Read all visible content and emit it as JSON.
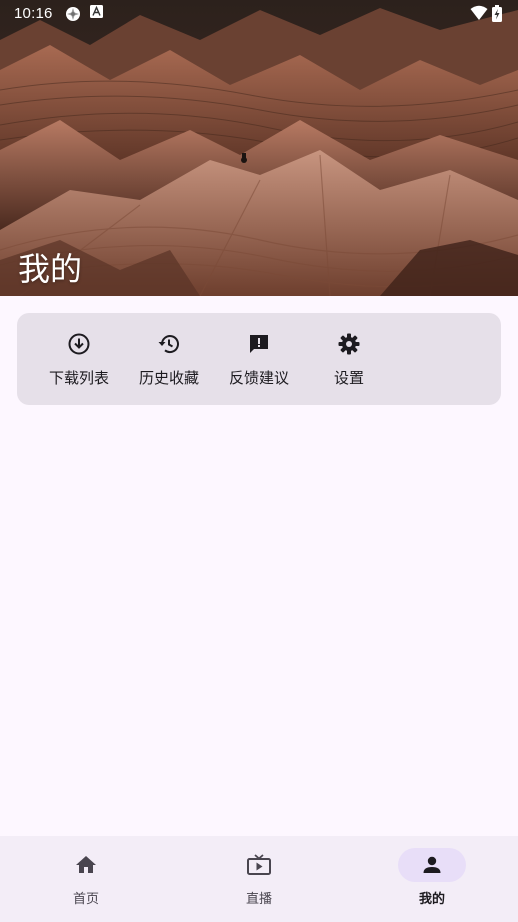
{
  "status_bar": {
    "time": "10:16",
    "icons": [
      "app-icon",
      "a-notification-icon",
      "wifi-icon",
      "battery-charging-icon"
    ]
  },
  "header": {
    "title": "我的"
  },
  "actions": [
    {
      "label": "下载列表",
      "icon": "download-icon"
    },
    {
      "label": "历史收藏",
      "icon": "history-icon"
    },
    {
      "label": "反馈建议",
      "icon": "feedback-icon"
    },
    {
      "label": "设置",
      "icon": "gear-icon"
    }
  ],
  "bottom_nav": {
    "items": [
      {
        "label": "首页",
        "icon": "home-icon",
        "active": false
      },
      {
        "label": "直播",
        "icon": "live-tv-icon",
        "active": false
      },
      {
        "label": "我的",
        "icon": "person-icon",
        "active": true
      }
    ]
  },
  "colors": {
    "background": "#fdf7ff",
    "card": "#e6e0e9",
    "nav_background": "#f3edf7",
    "nav_indicator": "#e8def8",
    "icon": "#1d1b20"
  }
}
